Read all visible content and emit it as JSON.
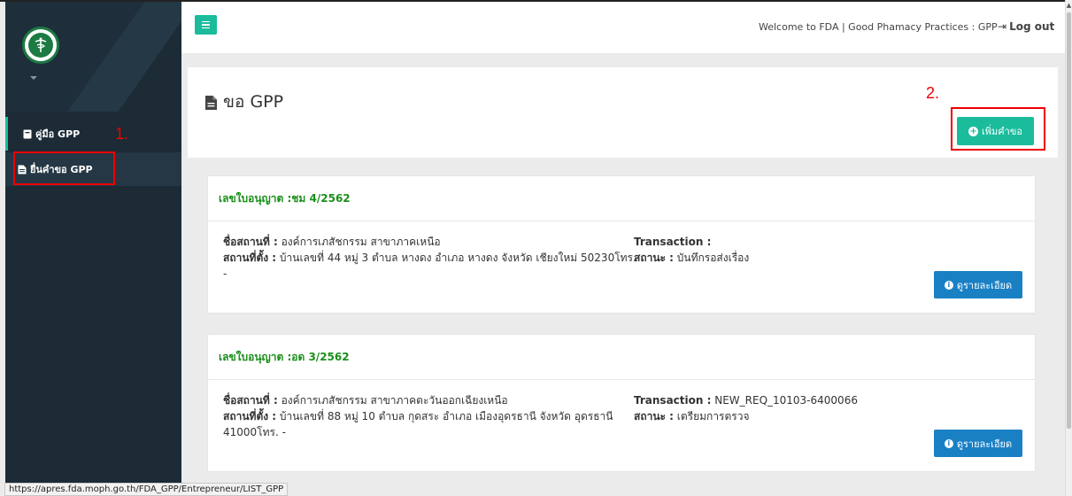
{
  "topbar": {
    "welcome": "Welcome to FDA | Good Phamacy Practices : GPP",
    "logout": "Log out"
  },
  "sidebar": {
    "items": [
      {
        "label": "คู่มือ GPP",
        "icon": "book-icon"
      },
      {
        "label": "ยื่นคำขอ GPP",
        "icon": "file-icon"
      }
    ]
  },
  "annotations": {
    "step1": "1.",
    "step2": "2."
  },
  "main": {
    "title": "ขอ GPP",
    "add_button": "เพิ่มคำขอ",
    "labels": {
      "name": "ชื่อสถานที่ :",
      "address": "สถานที่ตั้ง :",
      "transaction": "Transaction :",
      "status": "สถานะ :",
      "detail_button": "ดูรายละเอียด"
    },
    "cards": [
      {
        "license": "เลขใบอนุญาต :ชม 4/2562",
        "name": " องค์การเภสัชกรรม สาขาภาคเหนือ",
        "address": " บ้านเลขที่ 44 หมู่ 3 ตำบล หางดง อำเภอ หางดง จังหวัด เชียงใหม่ 50230โทร. -",
        "transaction": "",
        "status": " บันทึกรอส่งเรื่อง"
      },
      {
        "license": "เลขใบอนุญาต :อด 3/2562",
        "name": " องค์การเภสัชกรรม สาขาภาคตะวันออกเฉียงเหนือ",
        "address": " บ้านเลขที่ 88 หมู่ 10 ตำบล กุดสระ อำเภอ เมืองอุดรธานี จังหวัด อุดรธานี 41000โทร. -",
        "transaction": " NEW_REQ_10103-6400066",
        "status": " เตรียมการตรวจ"
      }
    ]
  },
  "statusbar": {
    "url": "https://apres.fda.moph.go.th/FDA_GPP/Entrepreneur/LIST_GPP"
  },
  "colors": {
    "accent": "#1abc9c",
    "info": "#1a80c4",
    "sidebar": "#1c2b36",
    "license_text": "#1a8f1a",
    "highlight": "#ee0000"
  }
}
